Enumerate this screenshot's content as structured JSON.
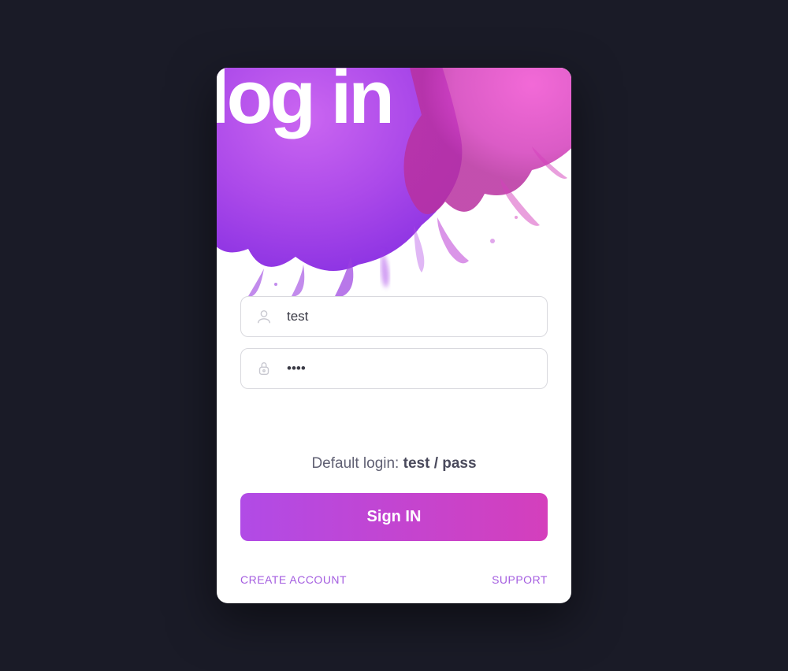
{
  "title": "log in",
  "fields": {
    "username": {
      "value": "test"
    },
    "password": {
      "value": "pass"
    }
  },
  "hint": {
    "label": "Default login: ",
    "credentials": "test / pass"
  },
  "buttons": {
    "signin": "Sign IN"
  },
  "footer": {
    "create": "CREATE ACCOUNT",
    "support": "SUPPORT"
  },
  "colors": {
    "bg": "#1a1b27",
    "accent1": "#b14be6",
    "accent2": "#d43fbc"
  }
}
